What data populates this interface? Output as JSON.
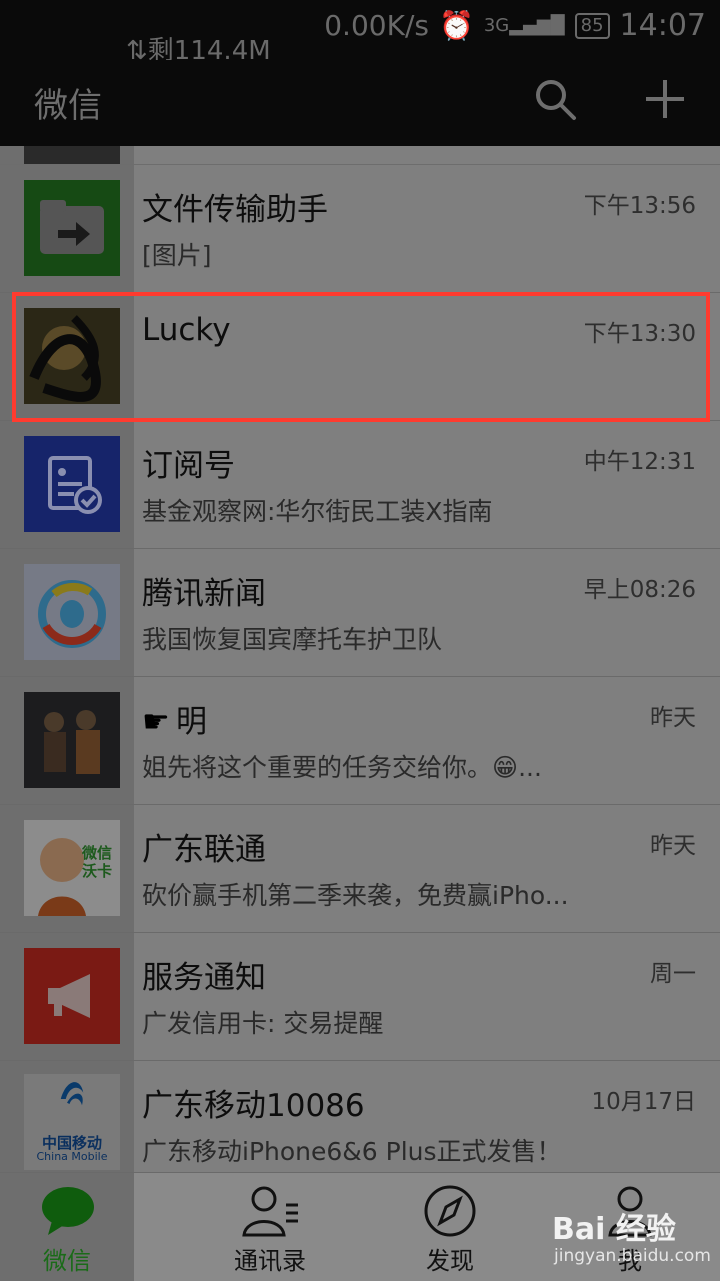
{
  "status": {
    "data_left": "剩114.4M",
    "speed": "0.00K/s",
    "network": "3G",
    "battery": "85",
    "time": "14:07"
  },
  "header": {
    "title": "微信",
    "search_icon": "search-icon",
    "add_icon": "plus-icon"
  },
  "chats": [
    {
      "name": "文件传输助手",
      "time": "下午13:56",
      "message": "[图片]"
    },
    {
      "name": "Lucky",
      "time": "下午13:30",
      "message": ""
    },
    {
      "name": "订阅号",
      "time": "中午12:31",
      "message": "基金观察网:华尔街民工装X指南"
    },
    {
      "name": "腾讯新闻",
      "time": "早上08:26",
      "message": "我国恢复国宾摩托车护卫队"
    },
    {
      "name": "明",
      "time": "昨天",
      "message": "姐先将这个重要的任务交给你。😁..."
    },
    {
      "name": "广东联通",
      "time": "昨天",
      "message": "砍价赢手机第二季来袭，免费赢iPho..."
    },
    {
      "name": "服务通知",
      "time": "周一",
      "message": "广发信用卡: 交易提醒"
    },
    {
      "name": "广东移动10086",
      "time": "10月17日",
      "message": "广东移动iPhone6&6 Plus正式发售！"
    }
  ],
  "avatar_text": {
    "liantong": "微信\n沃卡",
    "mobile_cn": "中国移动",
    "mobile_en": "China Mobile"
  },
  "tabs": [
    {
      "label": "微信",
      "icon": "chat-bubble-icon"
    },
    {
      "label": "通讯录",
      "icon": "contacts-icon"
    },
    {
      "label": "发现",
      "icon": "compass-icon"
    },
    {
      "label": "我",
      "icon": "person-icon"
    }
  ],
  "watermark": {
    "brand": "Bai 经验",
    "url": "jingyan.baidu.com"
  },
  "colors": {
    "highlight": "#ff3b2f",
    "active_tab": "#1a6b18",
    "bar": "#0a0a0a"
  }
}
